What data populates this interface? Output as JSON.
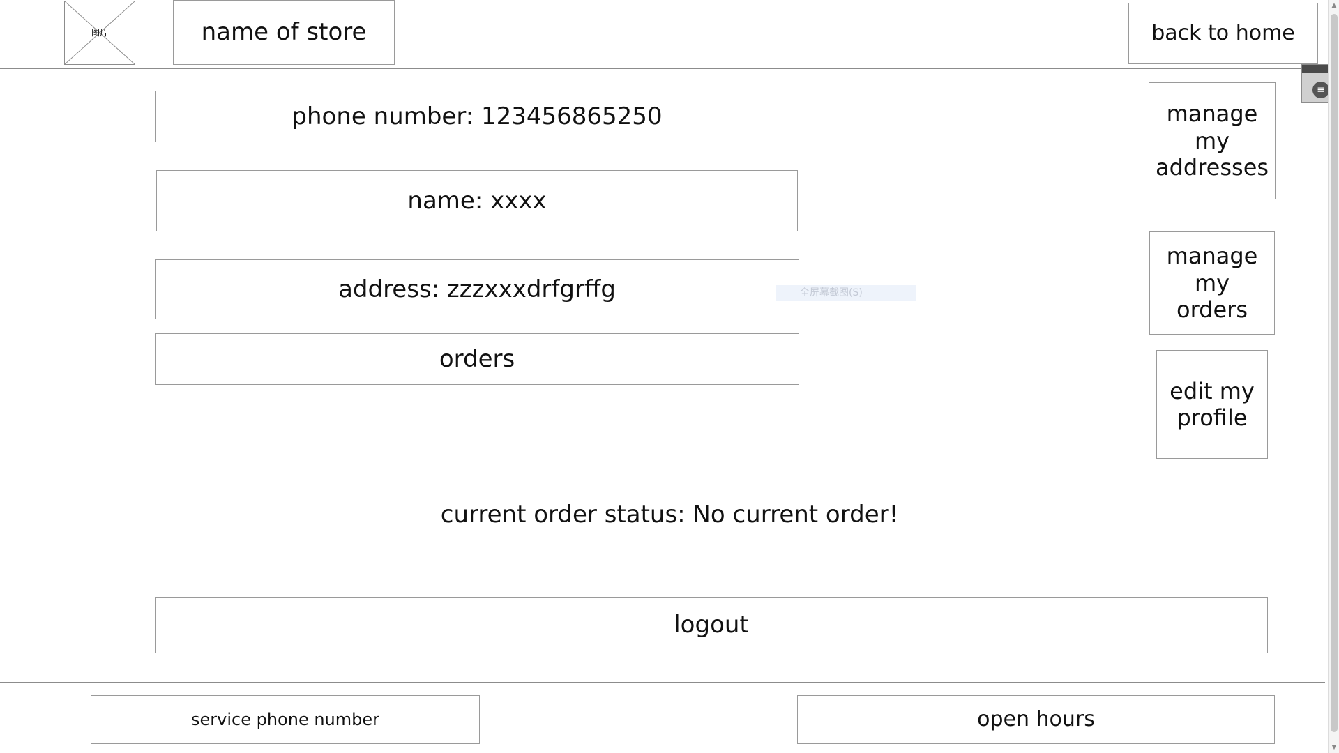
{
  "header": {
    "logo_text": "图片",
    "store_name": "name of store",
    "back_home_label": "back to home"
  },
  "profile": {
    "phone": "phone number:  123456865250",
    "name": "name: xxxx",
    "address": "address: zzzxxxdrfgrffg",
    "orders": "orders"
  },
  "sidebar": {
    "manage_addresses": "manage my addresses",
    "manage_orders": "manage my orders",
    "edit_profile": "edit my profile"
  },
  "status_text": "current order status: No current order!",
  "logout_label": "logout",
  "footer": {
    "service_phone": "service phone number",
    "open_hours": "open hours"
  },
  "ghost_tooltip": "全屏幕截图(S)",
  "icons": {
    "logo_placeholder": "image-placeholder-icon",
    "float_menu": "menu-icon",
    "scroll_up": "scroll-up-icon",
    "scroll_down": "scroll-down-icon"
  }
}
